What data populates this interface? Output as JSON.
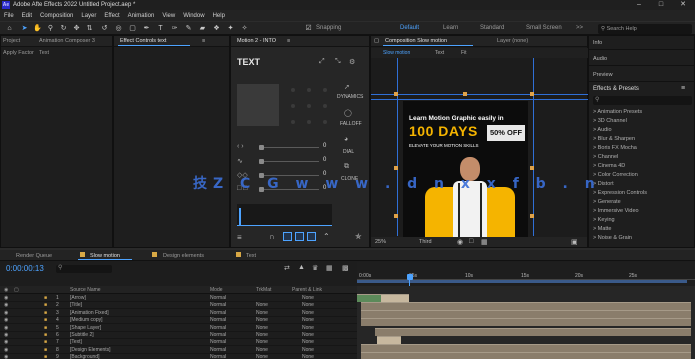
{
  "window": {
    "title": "Adobe Afte Effects 2022  Untitled Project.aep *",
    "logo_text": "Ae"
  },
  "menu": [
    "File",
    "Edit",
    "Composition",
    "Layer",
    "Effect",
    "Animation",
    "View",
    "Window",
    "Help"
  ],
  "toolbar": {
    "snapping_label": "Snapping",
    "workspaces": [
      "Default",
      "Learn",
      "Standard",
      "Small Screen"
    ],
    "active_workspace": "Default",
    "more": ">>",
    "search_placeholder": "Search Help"
  },
  "left_panel": {
    "tabs": [
      "Project",
      "Animation Composer 3"
    ],
    "subtabs": [
      "Apply Factor",
      "Text"
    ]
  },
  "effect_controls_tab": "Effect Controls text",
  "motion2_panel": {
    "tab": "Motion 2 - INTO",
    "header": "TEXT",
    "labels": [
      "DYNAMICS",
      "FALLOFF",
      "DIAL",
      "CLONE"
    ],
    "values": [
      "0",
      "0",
      "0",
      "0"
    ]
  },
  "composition_panel": {
    "tab": "Composition Slow motion",
    "layer_tab": "Layer (none)",
    "subtabs": [
      "Slow motion",
      "Text",
      "Fit"
    ],
    "zoom": "25%",
    "resolution": "Third",
    "poster": {
      "line1": "Learn Motion Graphic easily in",
      "big": "100 DAYS",
      "badge": "50% OFF",
      "line3": "ELEVATE YOUR MOTION SKILLS"
    }
  },
  "right_panel": {
    "items": [
      "Info",
      "Audio",
      "Preview"
    ],
    "effects_title": "Effects & Presets",
    "effects_search": "",
    "effects": [
      "> Animation Presets",
      "> 3D Channel",
      "> Audio",
      "> Blur & Sharpen",
      "> Boris FX Mocha",
      "> Channel",
      "> Cinema 4D",
      "> Color Correction",
      "> Distort",
      "> Expression Controls",
      "> Generate",
      "> Immersive Video",
      "> Keying",
      "> Matte",
      "> Noise & Grain"
    ]
  },
  "timeline": {
    "tabs": [
      "Render Queue",
      "Slow motion",
      "Design elements",
      "Text"
    ],
    "active_tab": "Slow motion",
    "timecode": "0:00:00:13",
    "columns": [
      "Source Name",
      "Mode",
      "TrkMat",
      "Parent & Link"
    ],
    "ruler": [
      "0:00s",
      "05s",
      "10s",
      "15s",
      "20s",
      "25s"
    ],
    "rows": [
      {
        "num": "1",
        "name": "[Arrow]",
        "mode": "Normal",
        "trk": "",
        "parent": "None"
      },
      {
        "num": "2",
        "name": "[Title]",
        "mode": "Normal",
        "trk": "None",
        "parent": "None"
      },
      {
        "num": "3",
        "name": "[Animation Fixed]",
        "mode": "Normal",
        "trk": "None",
        "parent": "None"
      },
      {
        "num": "4",
        "name": "[Medium copy]",
        "mode": "Normal",
        "trk": "None",
        "parent": "None"
      },
      {
        "num": "5",
        "name": "[Shape Layer]",
        "mode": "Normal",
        "trk": "None",
        "parent": "None"
      },
      {
        "num": "6",
        "name": "[Subtitle 2]",
        "mode": "Normal",
        "trk": "None",
        "parent": "None"
      },
      {
        "num": "7",
        "name": "[Text]",
        "mode": "Normal",
        "trk": "None",
        "parent": "None"
      },
      {
        "num": "8",
        "name": "[Design Elements]",
        "mode": "Normal",
        "trk": "None",
        "parent": "None"
      },
      {
        "num": "9",
        "name": "[Background]",
        "mode": "Normal",
        "trk": "None",
        "parent": "None"
      }
    ]
  },
  "watermark": "技Z C G  w w w . d n x x f b . n",
  "colors": {
    "accent": "#4da3ff",
    "poster_yellow": "#f5b400",
    "guide": "#2f6fd6"
  }
}
